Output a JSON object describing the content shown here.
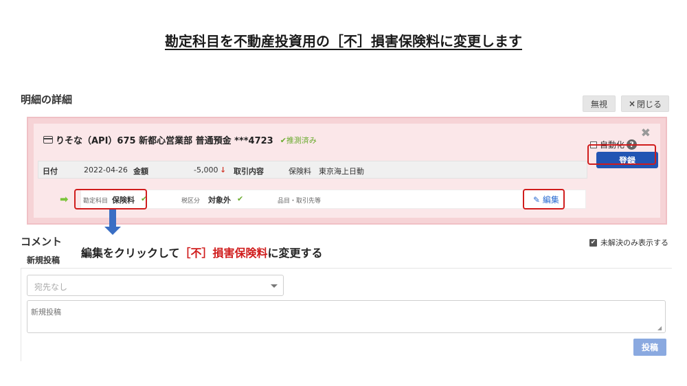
{
  "title": "勘定科目を不動産投資用の［不］損害保険料に変更します",
  "section_title": "明細の詳細",
  "buttons": {
    "ignore": "無視",
    "close_mark": "×",
    "close": "閉じる",
    "register": "登録",
    "post": "投稿"
  },
  "account": {
    "name": "りそな（API）675 新都心営業部 普通預金 ***4723",
    "status": "✔推測済み"
  },
  "auto": {
    "label": "自動化",
    "help": "?"
  },
  "detail": {
    "date_label": "日付",
    "date": "2022-04-26",
    "amount_label": "金額",
    "amount": "-5,000",
    "amount_arrow": "↓",
    "desc_label": "取引内容",
    "desc": "保険料　東京海上日動"
  },
  "entry": {
    "account_item_label": "勘定科目",
    "account_item": "保険料",
    "tax_label": "税区分",
    "tax": "対象外",
    "item_partner": "品目・取引先等",
    "edit": "編集",
    "check": "✔"
  },
  "comment": {
    "title": "コメント",
    "unresolved_only": "未解決のみ表示する",
    "new_post": "新規投稿",
    "recipient_placeholder": "宛先なし",
    "textarea_placeholder": "新規投稿"
  },
  "instruction": {
    "part1": "編集をクリックして",
    "part2": "［不］損害保険料",
    "part3": "に変更する"
  },
  "colors": {
    "primary": "#2255b3",
    "annotation_red": "#d01c1c",
    "panel_pink": "#f6d3d6",
    "check_green": "#6aab2e",
    "arrow_blue": "#3a6ec4"
  }
}
